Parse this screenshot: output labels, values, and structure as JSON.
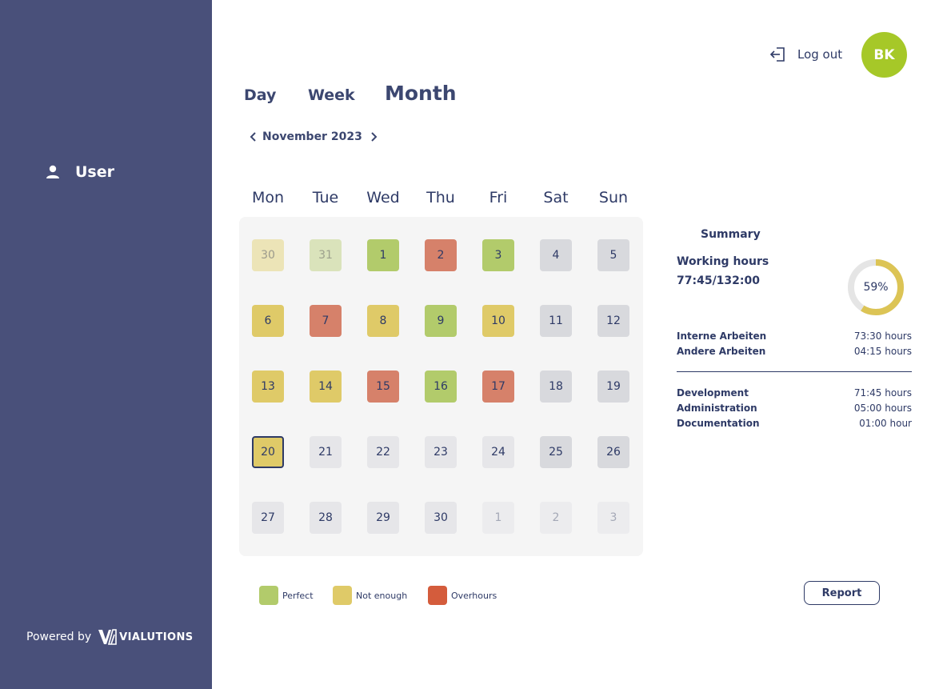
{
  "sidebar": {
    "user_label": "User",
    "powered_by": "Powered by",
    "logo_text": "VIALUTIONS"
  },
  "header": {
    "logout_label": "Log out",
    "avatar_initials": "BK"
  },
  "tabs": [
    {
      "label": "Day"
    },
    {
      "label": "Week"
    },
    {
      "label": "Month"
    }
  ],
  "calendar": {
    "month_label": "November 2023",
    "weekdays": [
      "Mon",
      "Tue",
      "Wed",
      "Thu",
      "Fri",
      "Sat",
      "Sun"
    ],
    "weeks": [
      [
        {
          "d": "30",
          "s": "pg-yellow"
        },
        {
          "d": "31",
          "s": "pg-green"
        },
        {
          "d": "1",
          "s": "green"
        },
        {
          "d": "2",
          "s": "red"
        },
        {
          "d": "3",
          "s": "green"
        },
        {
          "d": "4",
          "s": "wkend"
        },
        {
          "d": "5",
          "s": "wkend"
        }
      ],
      [
        {
          "d": "6",
          "s": "yellow"
        },
        {
          "d": "7",
          "s": "red"
        },
        {
          "d": "8",
          "s": "yellow"
        },
        {
          "d": "9",
          "s": "green"
        },
        {
          "d": "10",
          "s": "yellow"
        },
        {
          "d": "11",
          "s": "wkend"
        },
        {
          "d": "12",
          "s": "wkend"
        }
      ],
      [
        {
          "d": "13",
          "s": "yellow"
        },
        {
          "d": "14",
          "s": "yellow"
        },
        {
          "d": "15",
          "s": "red"
        },
        {
          "d": "16",
          "s": "green"
        },
        {
          "d": "17",
          "s": "red"
        },
        {
          "d": "18",
          "s": "wkend"
        },
        {
          "d": "19",
          "s": "wkend"
        }
      ],
      [
        {
          "d": "20",
          "s": "yellow today"
        },
        {
          "d": "21",
          "s": "wkday"
        },
        {
          "d": "22",
          "s": "wkday"
        },
        {
          "d": "23",
          "s": "wkday"
        },
        {
          "d": "24",
          "s": "wkday"
        },
        {
          "d": "25",
          "s": "wkend"
        },
        {
          "d": "26",
          "s": "wkend"
        }
      ],
      [
        {
          "d": "27",
          "s": "wkday"
        },
        {
          "d": "28",
          "s": "wkday"
        },
        {
          "d": "29",
          "s": "wkday"
        },
        {
          "d": "30",
          "s": "wkday"
        },
        {
          "d": "1",
          "s": "ng"
        },
        {
          "d": "2",
          "s": "ng"
        },
        {
          "d": "3",
          "s": "ng"
        }
      ]
    ]
  },
  "summary": {
    "title": "Summary",
    "working_hours_label": "Working hours",
    "working_hours_value": "77:45/132:00",
    "percent_label": "59%",
    "percent": 0.59,
    "groups": [
      {
        "label": "Interne Arbeiten",
        "value": "73:30 hours"
      },
      {
        "label": "Andere Arbeiten",
        "value": "04:15 hours"
      }
    ],
    "categories": [
      {
        "label": "Development",
        "value": "71:45 hours"
      },
      {
        "label": "Administration",
        "value": "05:00 hours"
      },
      {
        "label": "Documentation",
        "value": "01:00 hour"
      }
    ]
  },
  "legend": [
    {
      "label": "Perfect",
      "color": "#b2cb6b"
    },
    {
      "label": "Not enough",
      "color": "#dfca68"
    },
    {
      "label": "Overhours",
      "color": "#d45c3c"
    }
  ],
  "report_label": "Report",
  "colors": {
    "sidebar": "#49507a",
    "accent_avatar": "#a6c828",
    "donut_fill": "#dcc455",
    "donut_track": "#e5e5e5"
  }
}
